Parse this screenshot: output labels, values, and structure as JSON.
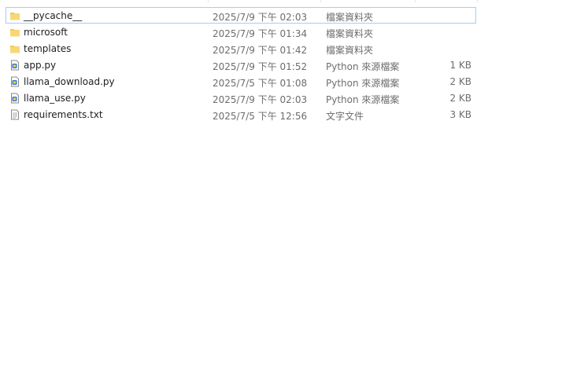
{
  "files": [
    {
      "name": "__pycache__",
      "modified": "2025/7/9 下午 02:03",
      "type": "檔案資料夾",
      "size": "",
      "icon": "folder-icon",
      "selected": true
    },
    {
      "name": "microsoft",
      "modified": "2025/7/9 下午 01:34",
      "type": "檔案資料夾",
      "size": "",
      "icon": "folder-icon",
      "selected": false
    },
    {
      "name": "templates",
      "modified": "2025/7/9 下午 01:42",
      "type": "檔案資料夾",
      "size": "",
      "icon": "folder-icon",
      "selected": false
    },
    {
      "name": "app.py",
      "modified": "2025/7/9 下午 01:52",
      "type": "Python 來源檔案",
      "size": "1 KB",
      "icon": "python-file-icon",
      "selected": false
    },
    {
      "name": "llama_download.py",
      "modified": "2025/7/5 下午 01:08",
      "type": "Python 來源檔案",
      "size": "2 KB",
      "icon": "python-file-icon",
      "selected": false
    },
    {
      "name": "llama_use.py",
      "modified": "2025/7/9 下午 02:03",
      "type": "Python 來源檔案",
      "size": "2 KB",
      "icon": "python-file-icon",
      "selected": false
    },
    {
      "name": "requirements.txt",
      "modified": "2025/7/5 下午 12:56",
      "type": "文字文件",
      "size": "3 KB",
      "icon": "text-file-icon",
      "selected": false
    }
  ],
  "colors": {
    "selection_border": "#99d1ff",
    "folder_yellow": "#f8d775",
    "python_blue": "#3a7bc8"
  }
}
